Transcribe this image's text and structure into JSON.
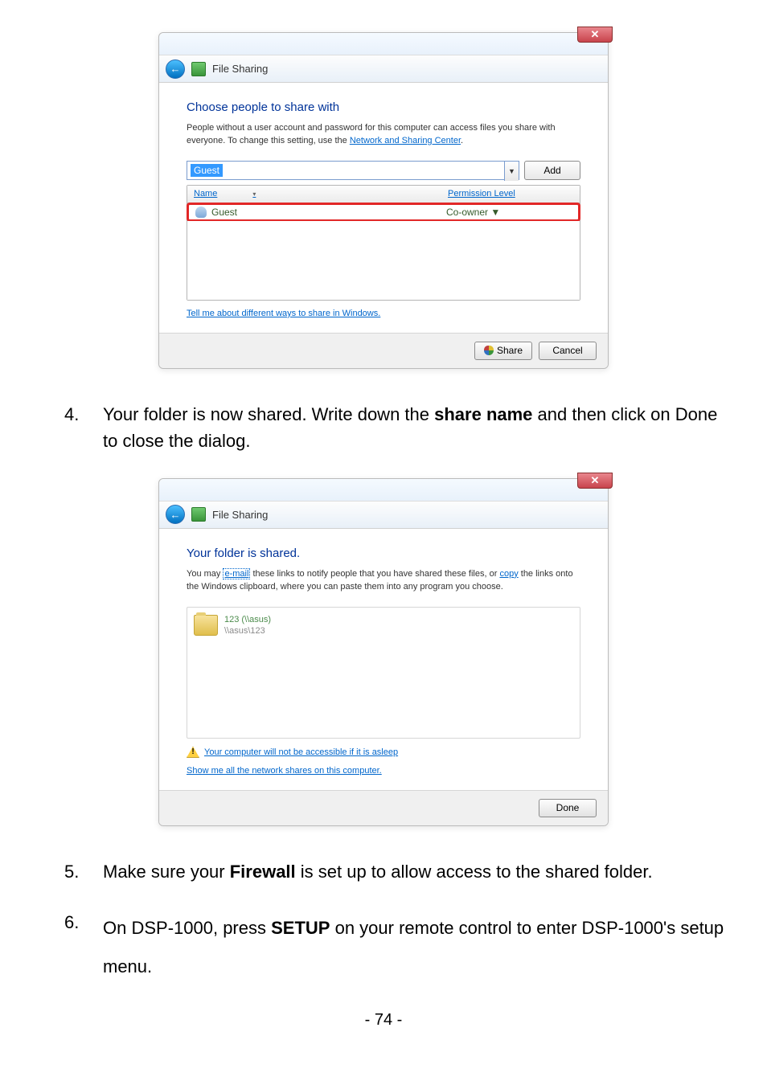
{
  "dialog1": {
    "subbar_title": "File Sharing",
    "heading": "Choose people to share with",
    "desc_part1": "People without a user account and password for this computer can access files you share with everyone. To change this setting, use the ",
    "desc_link": "Network and Sharing Center",
    "desc_part2": ".",
    "combo_value": "Guest",
    "dropdown_arrow": "▼",
    "add_label": "Add",
    "col_name": "Name",
    "col_perm": "Permission Level",
    "row_user": "Guest",
    "row_perm": "Co-owner ▼",
    "help_link": "Tell me about different ways to share in Windows.",
    "share_btn": "Share",
    "cancel_btn": "Cancel",
    "close_x": "✕"
  },
  "dialog2": {
    "subbar_title": "File Sharing",
    "heading": "Your folder is shared.",
    "desc_part1": "You may ",
    "desc_link1": "e-mail",
    "desc_part2": " these links to notify people that you have shared these files, or ",
    "desc_link2": "copy",
    "desc_part3": " the links onto the Windows clipboard, where you can paste them into any program you choose.",
    "share_name": "123 (\\\\asus)",
    "share_path": "\\\\asus\\123",
    "warn_link": "Your computer will not be accessible if it is asleep",
    "show_link": "Show me all the network shares on this computer.",
    "done_btn": "Done",
    "close_x": "✕",
    "warn_excl": "!"
  },
  "step4": {
    "num": "4.",
    "line1a": "Your folder is now shared. Write down the ",
    "line1b": "share name",
    "line1c": " and then click on Done",
    "line2": "to close the dialog."
  },
  "step5": {
    "num": "5.",
    "text_a": "Make sure your ",
    "text_b": "Firewall",
    "text_c": " is set up to allow access to the shared folder."
  },
  "step6": {
    "num": "6.",
    "text_a": "On DSP-1000, press ",
    "text_b": "SETUP",
    "text_c": " on your remote control to enter DSP-1000's setup menu."
  },
  "page_number": "- 74 -"
}
